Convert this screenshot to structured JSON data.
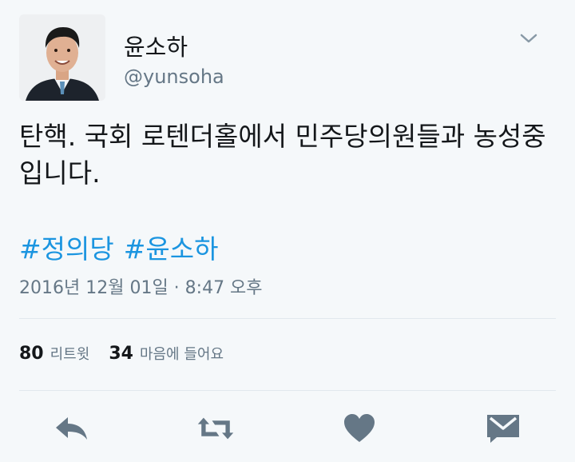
{
  "author": {
    "name": "윤소하",
    "handle": "@yunsoha"
  },
  "tweet": {
    "text": "탄핵. 국회 로텐더홀에서 민주당의원들과 농성중입니다.",
    "hashtags": [
      "#정의당",
      "#윤소하"
    ],
    "timestamp": "2016년 12월 01일 · 8:47 오후"
  },
  "stats": {
    "retweets_count": "80",
    "retweets_label": "리트윗",
    "likes_count": "34",
    "likes_label": "마음에 들어요"
  },
  "icons": {
    "menu": "chevron-down-icon",
    "reply": "reply-icon",
    "retweet": "retweet-icon",
    "like": "heart-icon",
    "message": "direct-message-icon"
  },
  "colors": {
    "background": "#f5f8fa",
    "hashtag": "#1b95e0",
    "muted": "#657786",
    "icon": "#657786"
  }
}
